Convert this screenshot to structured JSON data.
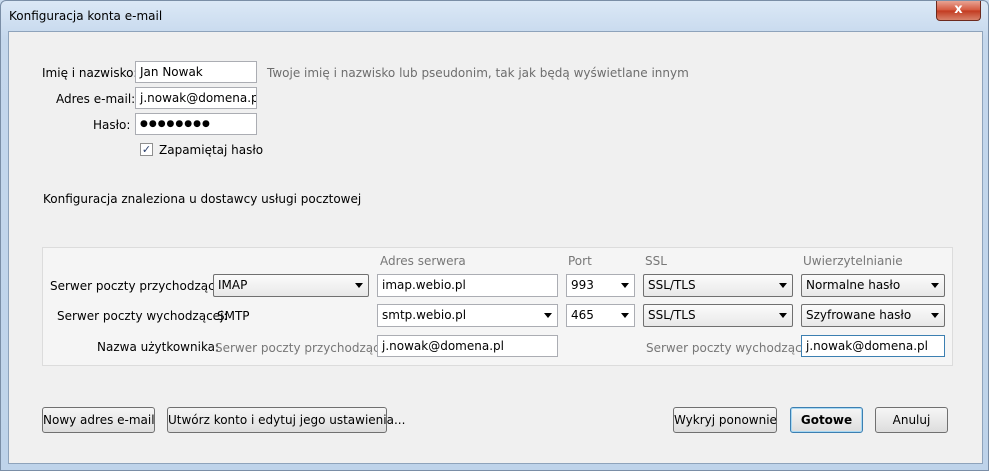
{
  "window": {
    "title": "Konfiguracja konta e-mail",
    "close_label": "x"
  },
  "identity": {
    "name_label": "Imię i nazwisko:",
    "name_value": "Jan Nowak",
    "name_hint": "Twoje imię i nazwisko lub pseudonim, tak jak będą wyświetlane innym",
    "email_label": "Adres e-mail:",
    "email_value": "j.nowak@domena.pl",
    "password_label": "Hasło:",
    "password_value": "●●●●●●●●",
    "remember_label": "Zapamiętaj hasło",
    "remember_checked": true
  },
  "status_text": "Konfiguracja znaleziona u dostawcy usługi pocztowej",
  "server_table": {
    "headers": {
      "address": "Adres serwera",
      "port": "Port",
      "ssl": "SSL",
      "auth": "Uwierzytelnianie"
    },
    "incoming": {
      "label": "Serwer poczty przychodzącej:",
      "protocol": "IMAP",
      "address": "imap.webio.pl",
      "port": "993",
      "ssl": "SSL/TLS",
      "auth": "Normalne hasło"
    },
    "outgoing": {
      "label": "Serwer poczty wychodzącej:",
      "protocol": "SMTP",
      "address": "smtp.webio.pl",
      "port": "465",
      "ssl": "SSL/TLS",
      "auth": "Szyfrowane hasło"
    },
    "username": {
      "label": "Nazwa użytkownika:",
      "incoming_label": "Serwer poczty przychodzącej:",
      "incoming_value": "j.nowak@domena.pl",
      "outgoing_label": "Serwer poczty wychodzącej:",
      "outgoing_value": "j.nowak@domena.pl"
    }
  },
  "buttons": {
    "new_address": "Nowy adres e-mail",
    "create_edit": "Utwórz konto i edytuj jego ustawienia...",
    "redetect": "Wykryj ponownie",
    "done": "Gotowe",
    "cancel": "Anuluj"
  }
}
